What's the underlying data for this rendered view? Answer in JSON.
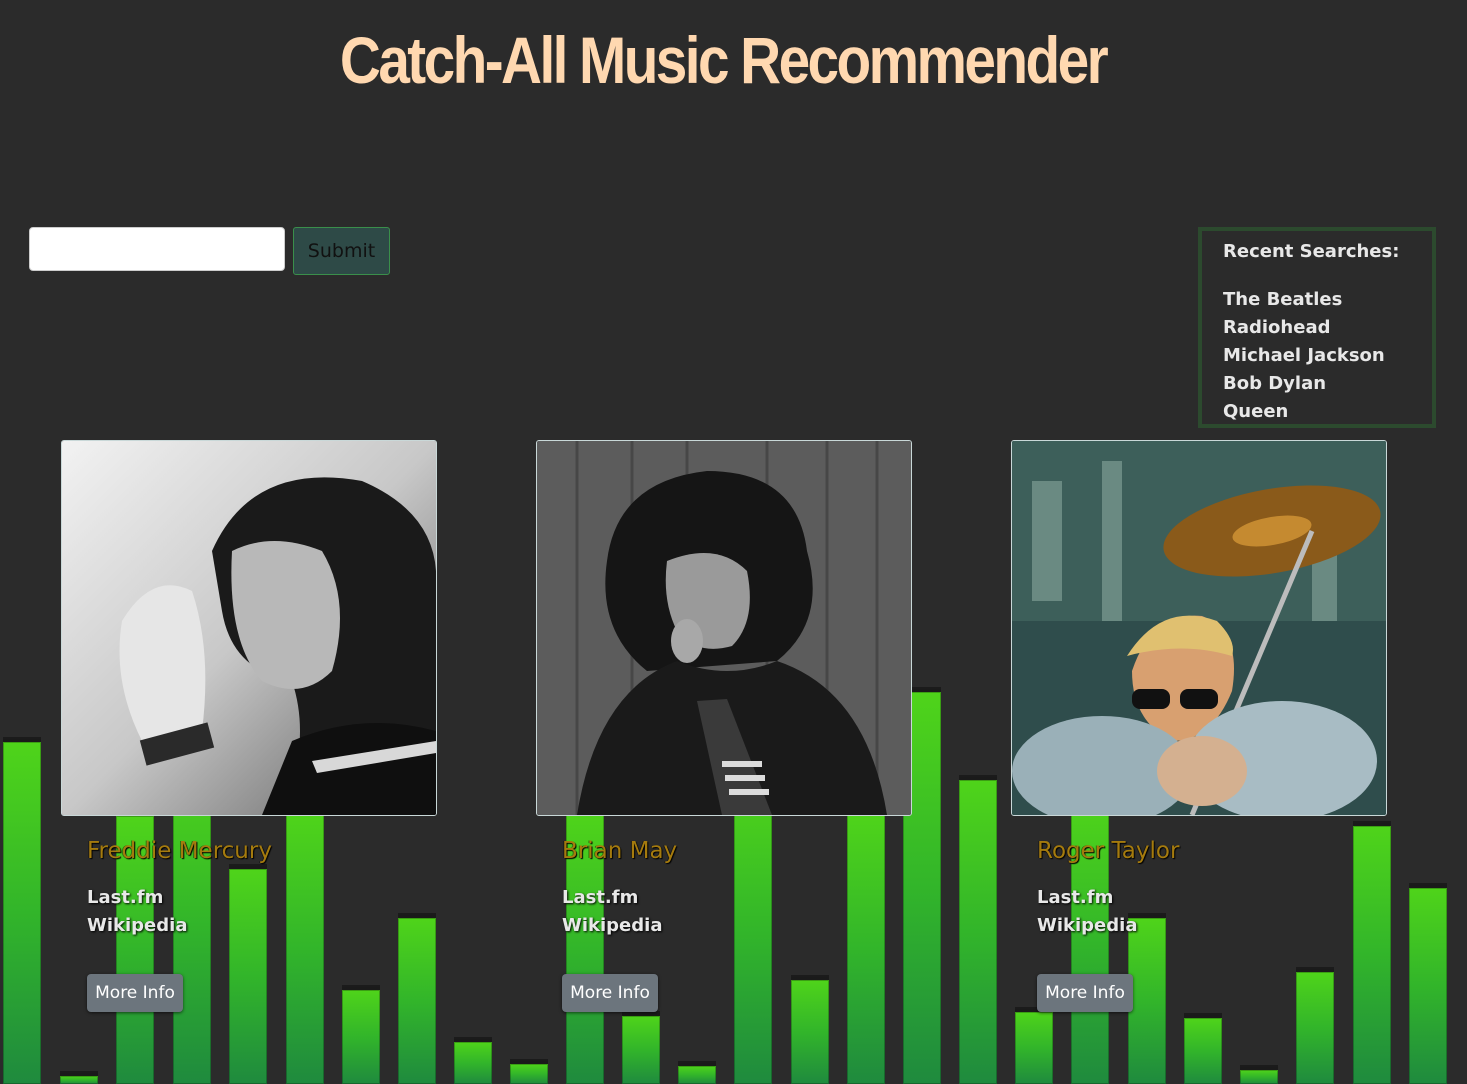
{
  "page": {
    "title": "Catch-All Music Recommender"
  },
  "search": {
    "input_value": "",
    "placeholder": "",
    "submit_label": "Submit"
  },
  "recent_searches": {
    "heading": "Recent Searches:",
    "items": [
      "The Beatles",
      "Radiohead",
      "Michael Jackson",
      "Bob Dylan",
      "Queen"
    ]
  },
  "cards": [
    {
      "name": "Freddie Mercury",
      "link1": "Last.fm",
      "link2": "Wikipedia",
      "button": "More Info",
      "photo": "freddie-mercury-photo"
    },
    {
      "name": "Brian May",
      "link1": "Last.fm",
      "link2": "Wikipedia",
      "button": "More Info",
      "photo": "brian-may-photo"
    },
    {
      "name": "Roger Taylor",
      "link1": "Last.fm",
      "link2": "Wikipedia",
      "button": "More Info",
      "photo": "roger-taylor-photo"
    }
  ],
  "colors": {
    "background": "#2b2b2b",
    "title": "#ffd8b0",
    "name": "#a57b0e",
    "bar_top": "#4fd41a",
    "bar_bottom": "#1f8a3e",
    "recent_border": "#2c4a2e",
    "button": "#6c757d"
  }
}
